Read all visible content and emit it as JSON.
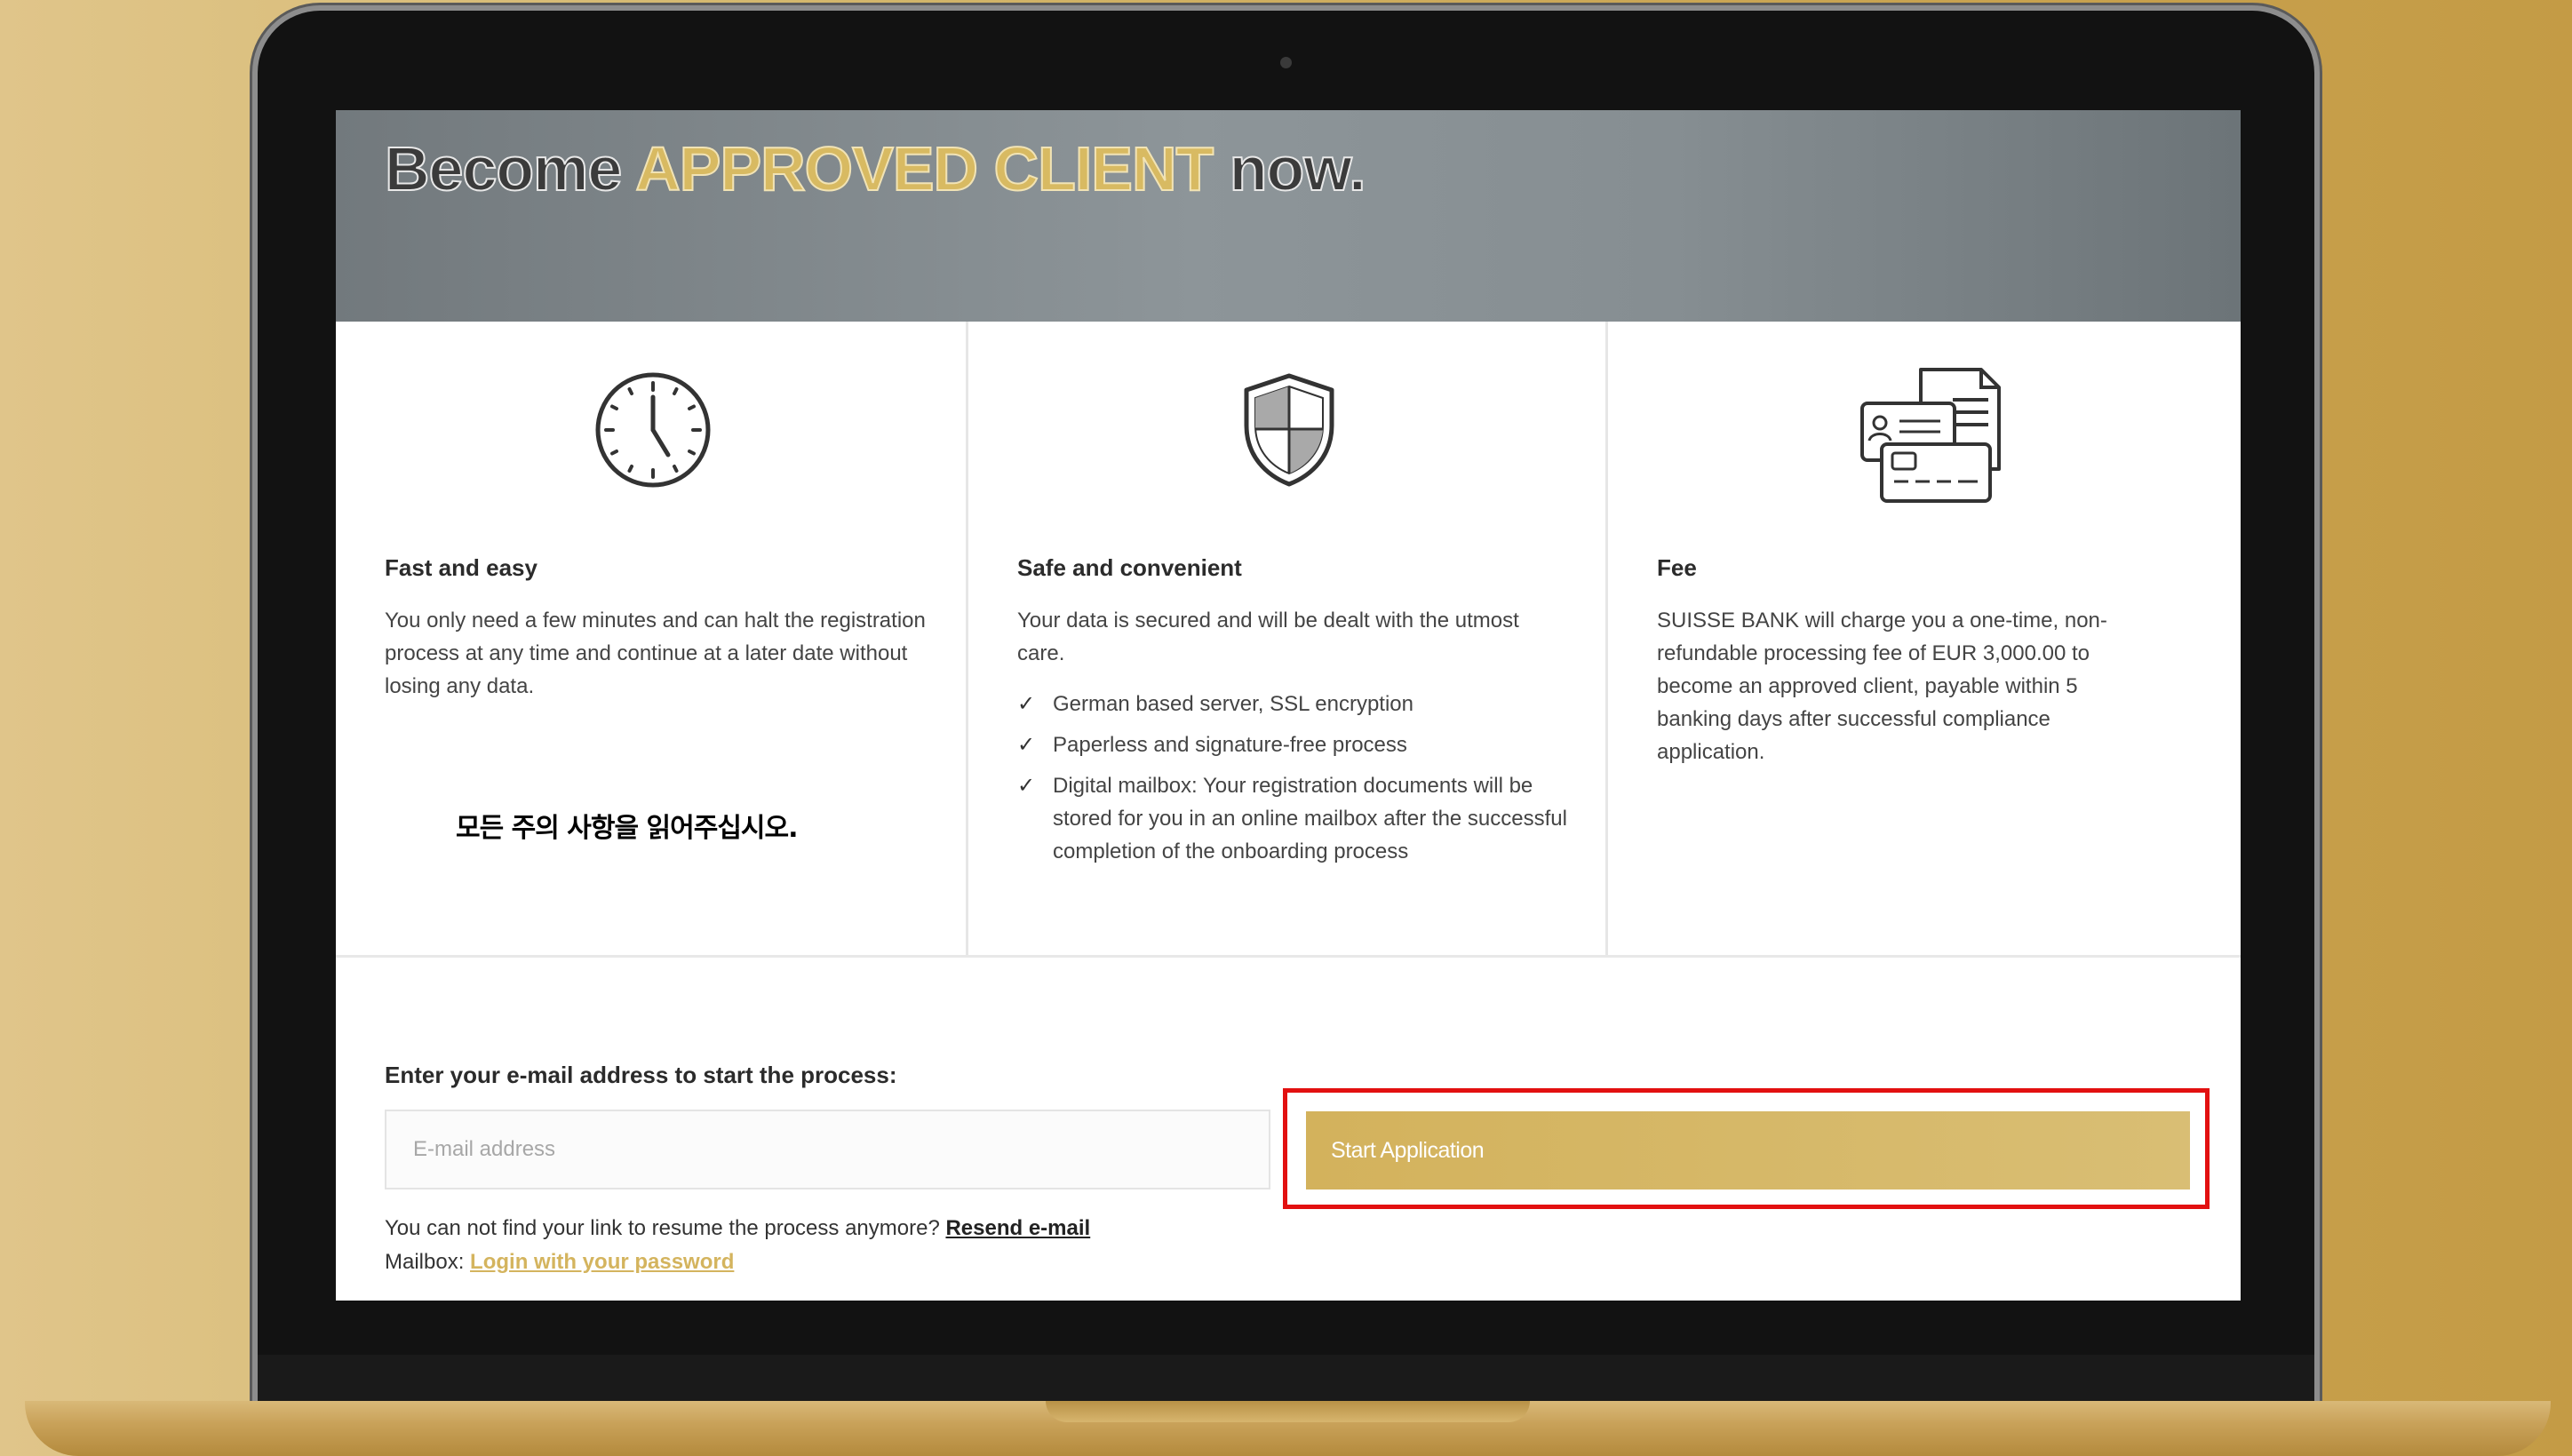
{
  "hero": {
    "title_prefix": "Become ",
    "title_accent": "APPROVED CLIENT",
    "title_suffix": " now."
  },
  "columns": [
    {
      "icon": "clock-icon",
      "title": "Fast and easy",
      "text": "You only need a few minutes and can halt the registration process at any time and continue at a later date without losing any data."
    },
    {
      "icon": "shield-icon",
      "title": "Safe and convenient",
      "text": "Your data is secured and will be dealt with the utmost care.",
      "checklist": [
        "German based server, SSL encryption",
        "Paperless and signature-free process",
        "Digital mailbox: Your registration documents will be stored for you in an online mailbox after the successful completion of the onboarding process"
      ]
    },
    {
      "icon": "documents-id-card-icon",
      "title": "Fee",
      "text": "SUISSE BANK will charge you a one-time, non-refundable processing fee of EUR 3,000.00 to become an approved client, payable within 5 banking days after successful compliance application."
    }
  ],
  "overlay_note": "모든 주의 사항을 읽어주십시오.",
  "form": {
    "label": "Enter your e-mail address to start the process:",
    "email_placeholder": "E-mail address",
    "email_value": "",
    "submit_label": "Start Application",
    "resume_text": "You can not find your link to resume the process anymore? ",
    "resend_link": "Resend e-mail",
    "mailbox_text": "Mailbox: ",
    "login_link": "Login with your password"
  },
  "colors": {
    "accent_gold": "#d4b45e",
    "highlight_red": "#e21010",
    "hero_gray": "#7f878b"
  }
}
